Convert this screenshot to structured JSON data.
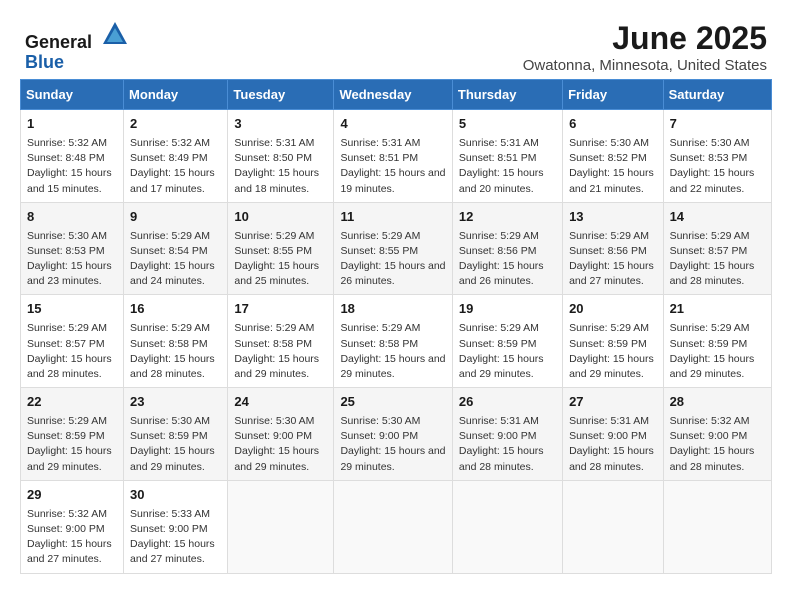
{
  "header": {
    "logo_line1": "General",
    "logo_line2": "Blue",
    "month_year": "June 2025",
    "location": "Owatonna, Minnesota, United States"
  },
  "weekdays": [
    "Sunday",
    "Monday",
    "Tuesday",
    "Wednesday",
    "Thursday",
    "Friday",
    "Saturday"
  ],
  "weeks": [
    [
      {
        "day": "1",
        "sunrise": "5:32 AM",
        "sunset": "8:48 PM",
        "daylight": "15 hours and 15 minutes."
      },
      {
        "day": "2",
        "sunrise": "5:32 AM",
        "sunset": "8:49 PM",
        "daylight": "15 hours and 17 minutes."
      },
      {
        "day": "3",
        "sunrise": "5:31 AM",
        "sunset": "8:50 PM",
        "daylight": "15 hours and 18 minutes."
      },
      {
        "day": "4",
        "sunrise": "5:31 AM",
        "sunset": "8:51 PM",
        "daylight": "15 hours and 19 minutes."
      },
      {
        "day": "5",
        "sunrise": "5:31 AM",
        "sunset": "8:51 PM",
        "daylight": "15 hours and 20 minutes."
      },
      {
        "day": "6",
        "sunrise": "5:30 AM",
        "sunset": "8:52 PM",
        "daylight": "15 hours and 21 minutes."
      },
      {
        "day": "7",
        "sunrise": "5:30 AM",
        "sunset": "8:53 PM",
        "daylight": "15 hours and 22 minutes."
      }
    ],
    [
      {
        "day": "8",
        "sunrise": "5:30 AM",
        "sunset": "8:53 PM",
        "daylight": "15 hours and 23 minutes."
      },
      {
        "day": "9",
        "sunrise": "5:29 AM",
        "sunset": "8:54 PM",
        "daylight": "15 hours and 24 minutes."
      },
      {
        "day": "10",
        "sunrise": "5:29 AM",
        "sunset": "8:55 PM",
        "daylight": "15 hours and 25 minutes."
      },
      {
        "day": "11",
        "sunrise": "5:29 AM",
        "sunset": "8:55 PM",
        "daylight": "15 hours and 26 minutes."
      },
      {
        "day": "12",
        "sunrise": "5:29 AM",
        "sunset": "8:56 PM",
        "daylight": "15 hours and 26 minutes."
      },
      {
        "day": "13",
        "sunrise": "5:29 AM",
        "sunset": "8:56 PM",
        "daylight": "15 hours and 27 minutes."
      },
      {
        "day": "14",
        "sunrise": "5:29 AM",
        "sunset": "8:57 PM",
        "daylight": "15 hours and 28 minutes."
      }
    ],
    [
      {
        "day": "15",
        "sunrise": "5:29 AM",
        "sunset": "8:57 PM",
        "daylight": "15 hours and 28 minutes."
      },
      {
        "day": "16",
        "sunrise": "5:29 AM",
        "sunset": "8:58 PM",
        "daylight": "15 hours and 28 minutes."
      },
      {
        "day": "17",
        "sunrise": "5:29 AM",
        "sunset": "8:58 PM",
        "daylight": "15 hours and 29 minutes."
      },
      {
        "day": "18",
        "sunrise": "5:29 AM",
        "sunset": "8:58 PM",
        "daylight": "15 hours and 29 minutes."
      },
      {
        "day": "19",
        "sunrise": "5:29 AM",
        "sunset": "8:59 PM",
        "daylight": "15 hours and 29 minutes."
      },
      {
        "day": "20",
        "sunrise": "5:29 AM",
        "sunset": "8:59 PM",
        "daylight": "15 hours and 29 minutes."
      },
      {
        "day": "21",
        "sunrise": "5:29 AM",
        "sunset": "8:59 PM",
        "daylight": "15 hours and 29 minutes."
      }
    ],
    [
      {
        "day": "22",
        "sunrise": "5:29 AM",
        "sunset": "8:59 PM",
        "daylight": "15 hours and 29 minutes."
      },
      {
        "day": "23",
        "sunrise": "5:30 AM",
        "sunset": "8:59 PM",
        "daylight": "15 hours and 29 minutes."
      },
      {
        "day": "24",
        "sunrise": "5:30 AM",
        "sunset": "9:00 PM",
        "daylight": "15 hours and 29 minutes."
      },
      {
        "day": "25",
        "sunrise": "5:30 AM",
        "sunset": "9:00 PM",
        "daylight": "15 hours and 29 minutes."
      },
      {
        "day": "26",
        "sunrise": "5:31 AM",
        "sunset": "9:00 PM",
        "daylight": "15 hours and 28 minutes."
      },
      {
        "day": "27",
        "sunrise": "5:31 AM",
        "sunset": "9:00 PM",
        "daylight": "15 hours and 28 minutes."
      },
      {
        "day": "28",
        "sunrise": "5:32 AM",
        "sunset": "9:00 PM",
        "daylight": "15 hours and 28 minutes."
      }
    ],
    [
      {
        "day": "29",
        "sunrise": "5:32 AM",
        "sunset": "9:00 PM",
        "daylight": "15 hours and 27 minutes."
      },
      {
        "day": "30",
        "sunrise": "5:33 AM",
        "sunset": "9:00 PM",
        "daylight": "15 hours and 27 minutes."
      },
      null,
      null,
      null,
      null,
      null
    ]
  ]
}
